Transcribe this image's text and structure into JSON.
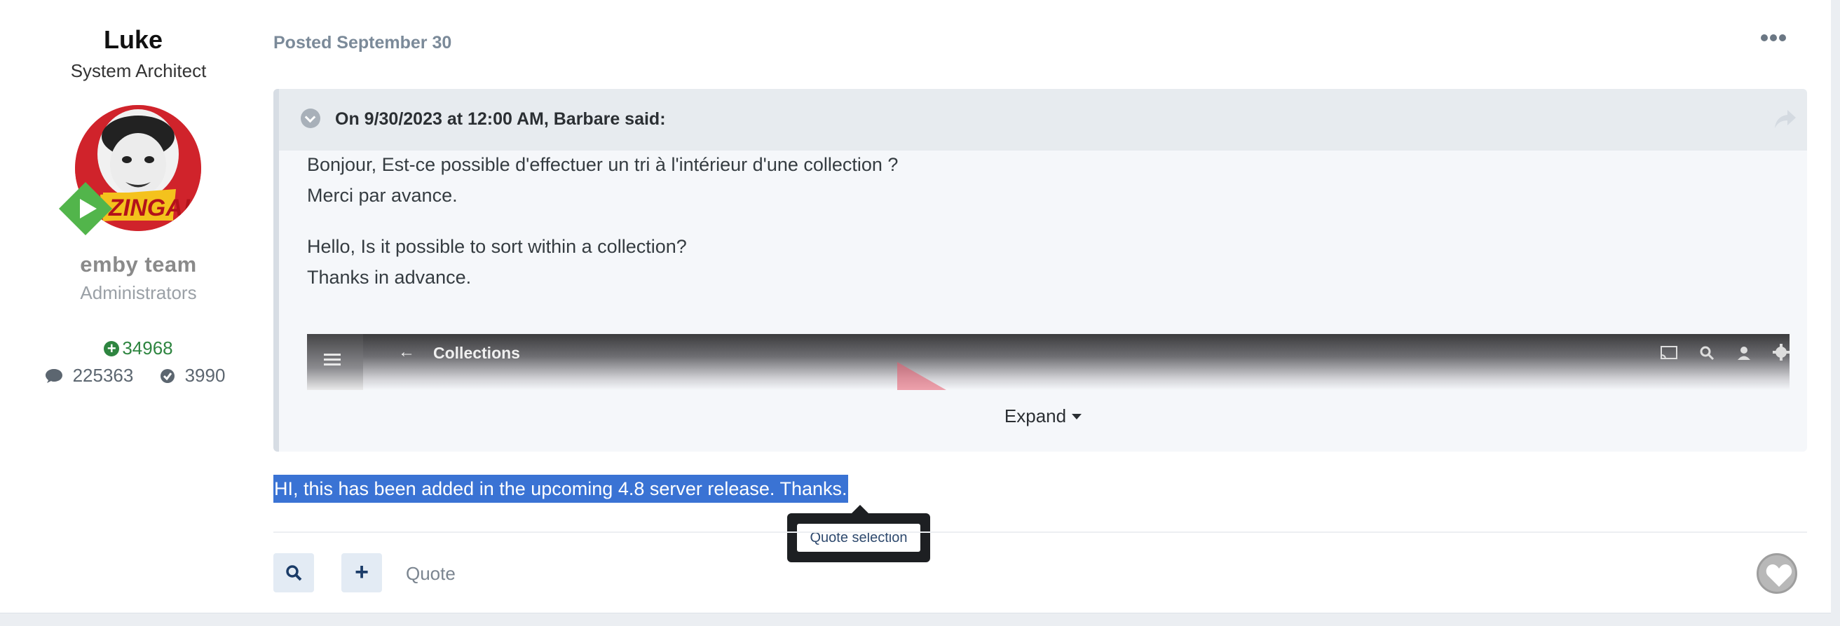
{
  "author": {
    "name": "Luke",
    "title": "System Architect",
    "group_logo": "emby team",
    "group": "Administrators",
    "reputation": "34968",
    "posts": "225363",
    "solutions": "3990"
  },
  "post": {
    "posted_label": "Posted September 30",
    "quote": {
      "citation": "On 9/30/2023 at 12:00 AM, Barbare said:",
      "lines": [
        "Bonjour, Est-ce possible d'effectuer un tri à l'intérieur d'une collection ?",
        "Merci par avance.",
        "Hello, Is it possible to sort within a collection?",
        "Thanks in advance."
      ],
      "embed": {
        "title": "Collections"
      },
      "expand_label": "Expand"
    },
    "reply_text": "HI, this has been added in the upcoming 4.8 server release. Thanks.",
    "tooltip_label": "Quote selection",
    "quote_label": "Quote"
  },
  "colors": {
    "accent": "#3a73d4",
    "reputation": "#2e8540",
    "tool_button_bg": "#e3ebf4"
  },
  "icons": [
    "play-badge-icon",
    "comment-icon",
    "check-circle-icon",
    "more-icon",
    "chevron-down-icon",
    "share-icon",
    "search-icon",
    "plus-icon",
    "heart-icon"
  ]
}
